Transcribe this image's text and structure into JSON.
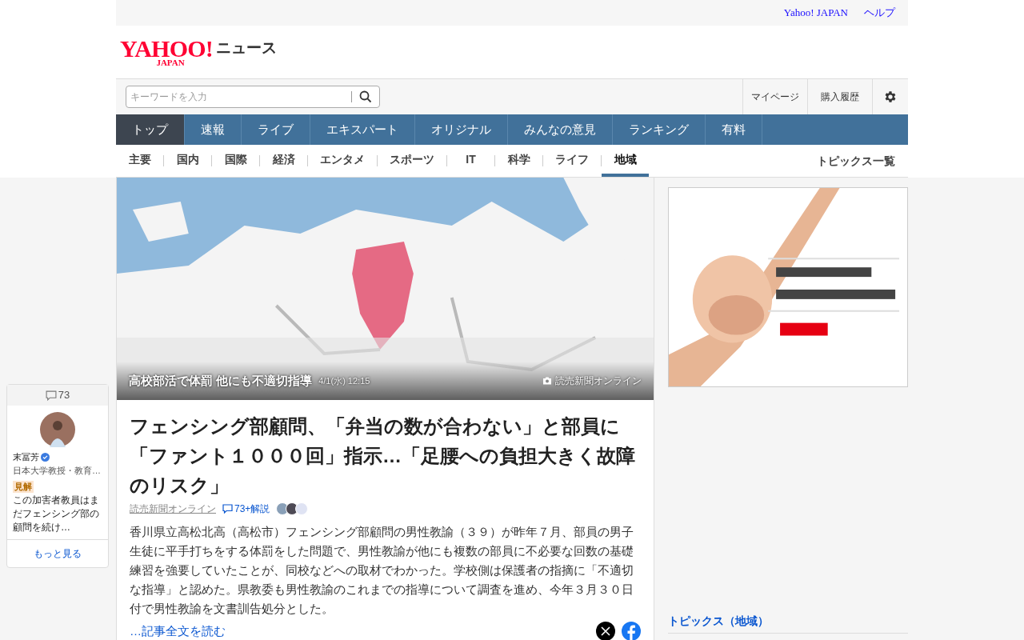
{
  "top_links": [
    "Yahoo! JAPAN",
    "ヘルプ"
  ],
  "logo": {
    "brand": "YAHOO!",
    "sub": "JAPAN",
    "service": "ニュース"
  },
  "search": {
    "placeholder": "キーワードを入力"
  },
  "header_links": [
    "マイページ",
    "購入履歴"
  ],
  "nav_tabs": [
    {
      "label": "トップ",
      "selected": true
    },
    {
      "label": "速報",
      "selected": false
    },
    {
      "label": "ライブ",
      "selected": false
    },
    {
      "label": "エキスパート",
      "selected": false
    },
    {
      "label": "オリジナル",
      "selected": false
    },
    {
      "label": "みんなの意見",
      "selected": false
    },
    {
      "label": "ランキング",
      "selected": false
    },
    {
      "label": "有料",
      "selected": false
    }
  ],
  "sub_tabs": [
    {
      "label": "主要",
      "selected": false
    },
    {
      "label": "国内",
      "selected": false
    },
    {
      "label": "国際",
      "selected": false
    },
    {
      "label": "経済",
      "selected": false
    },
    {
      "label": "エンタメ",
      "selected": false
    },
    {
      "label": "スポーツ",
      "selected": false
    },
    {
      "label": "IT",
      "selected": false
    },
    {
      "label": "科学",
      "selected": false
    },
    {
      "label": "ライフ",
      "selected": false
    },
    {
      "label": "地域",
      "selected": true
    }
  ],
  "topics_link": "トピックス一覧",
  "hero": {
    "caption": "高校部活で体罰 他にも不適切指導",
    "time": "4/1(水) 12:15",
    "source": "読売新聞オンライン"
  },
  "article": {
    "title": "フェンシング部顧問、「弁当の数が合わない」と部員に「ファント１０００回」指示…「足腰への負担大きく故障のリスク」",
    "source": "読売新聞オンライン",
    "comments": "73+解説",
    "body": "香川県立高松北高（高松市）フェンシング部顧問の男性教諭（３９）が昨年７月、部員の男子生徒に平手打ちをする体罰をした問題で、男性教諭が他にも複数の部員に不必要な回数の基礎練習を強要していたことが、同校などへの取材でわかった。学校側は保護者の指摘に「不適切な指導」と認めた。県教委も男性教諭のこれまでの指導について調査を進め、今年３月３０日付で男性教諭を文書訓告処分とした。",
    "read_more": "…記事全文を読む"
  },
  "side_comment": {
    "count": "73",
    "name": "末冨芳",
    "verified": true,
    "affiliation": "日本大学教授・教育…",
    "tag": "見解",
    "text": "この加害者教員はまだフェンシング部の顧問を続け…",
    "more": "もっと見る"
  },
  "right": {
    "topics_heading": "トピックス（地域）"
  }
}
